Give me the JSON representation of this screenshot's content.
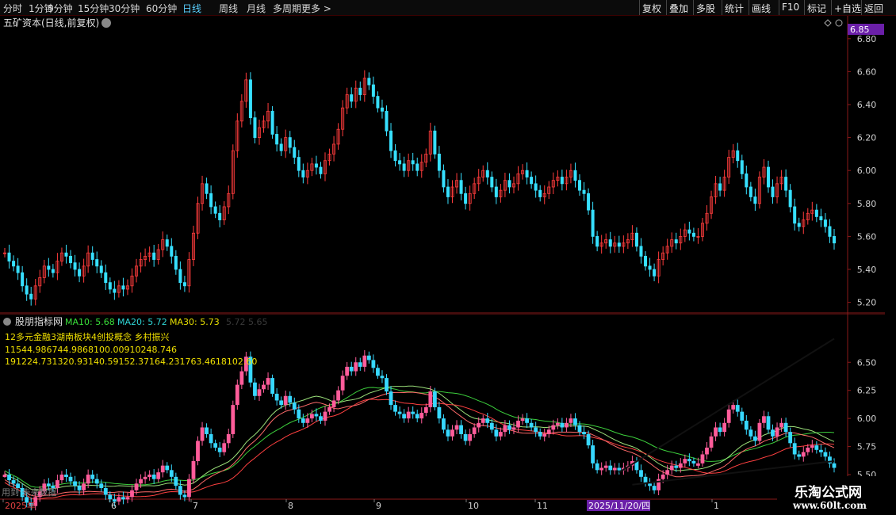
{
  "toolbar": {
    "periods": [
      "分时",
      "1分钟",
      "5分钟",
      "15分钟",
      "30分钟",
      "60分钟",
      "日线",
      "周线",
      "月线",
      "多周期",
      "更多 >"
    ],
    "active_period": "日线",
    "right_buttons": [
      "复权",
      "叠加",
      "多股",
      "统计",
      "画线",
      "F10",
      "标记",
      "+自选",
      "返回"
    ]
  },
  "main_chart": {
    "title": "五矿资本(日线,前复权)",
    "current_price_tag": "6.85",
    "y_ticks": [
      "6.80",
      "6.60",
      "6.40",
      "6.20",
      "6.00",
      "5.80",
      "5.60",
      "5.40",
      "5.20"
    ]
  },
  "sub_chart": {
    "indicator_name": "股朋指标网",
    "ma_labels": [
      "MA10: 5.68",
      "MA20: 5.72",
      "MA30: 5.73"
    ],
    "ma_faded": "5.72  5.65",
    "info_line1": "12多元金融3湖南板块4创投概念 乡村振兴",
    "info_line2": "11544.986744.9868100.00910248.746",
    "info_line3": "191224.731320.93140.59152.37164.231763.4618102.60",
    "y_ticks": [
      "6.50",
      "6.25",
      "6.00",
      "5.75",
      "5.50"
    ],
    "bottom_left_text": "用到   未来数据"
  },
  "x_axis": {
    "labels": [
      "2025年",
      "6",
      "7",
      "8",
      "9",
      "10",
      "11",
      "1"
    ],
    "highlight_date": "2025/11/20/四"
  },
  "watermark": {
    "title": "乐淘公式网",
    "url": "www.60lt.com"
  },
  "colors": {
    "up_main": "#ff3c3c",
    "down_main": "#37e0ff",
    "up_sub": "#ff5c9a",
    "down_sub": "#37d8ff",
    "ma_green": "#3ccf3c",
    "ma_red": "#ff4040",
    "ma_yellow": "#e6d34a",
    "axis_red": "#8a1a1a"
  },
  "chart_data": {
    "type": "candlestick",
    "title": "五矿资本(日线,前复权)",
    "y_range_main": [
      5.15,
      6.9
    ],
    "y_range_sub": [
      5.38,
      6.65
    ],
    "series": [
      {
        "name": "price",
        "close_values": [
          5.5,
          5.45,
          5.42,
          5.38,
          5.3,
          5.25,
          5.22,
          5.3,
          5.35,
          5.42,
          5.4,
          5.38,
          5.45,
          5.5,
          5.48,
          5.44,
          5.4,
          5.36,
          5.42,
          5.5,
          5.46,
          5.42,
          5.38,
          5.32,
          5.28,
          5.26,
          5.3,
          5.28,
          5.3,
          5.36,
          5.42,
          5.46,
          5.48,
          5.5,
          5.46,
          5.52,
          5.58,
          5.54,
          5.48,
          5.4,
          5.32,
          5.3,
          5.46,
          5.62,
          5.8,
          5.92,
          5.86,
          5.78,
          5.74,
          5.7,
          5.78,
          5.86,
          6.12,
          6.3,
          6.42,
          6.55,
          6.32,
          6.2,
          6.26,
          6.3,
          6.36,
          6.22,
          6.16,
          6.12,
          6.2,
          6.14,
          6.08,
          6.0,
          5.96,
          6.0,
          6.04,
          6.02,
          5.98,
          6.06,
          6.1,
          6.16,
          6.25,
          6.38,
          6.46,
          6.42,
          6.5,
          6.46,
          6.56,
          6.52,
          6.45,
          6.38,
          6.36,
          6.24,
          6.12,
          6.06,
          6.04,
          6.0,
          6.06,
          6.04,
          6.0,
          6.05,
          6.1,
          6.24,
          6.1,
          6.0,
          5.9,
          5.84,
          5.9,
          5.94,
          5.86,
          5.8,
          5.86,
          5.92,
          5.96,
          6.0,
          5.96,
          5.9,
          5.84,
          5.88,
          5.94,
          5.9,
          5.92,
          5.98,
          6.0,
          5.96,
          5.92,
          5.88,
          5.84,
          5.86,
          5.9,
          5.94,
          5.96,
          5.92,
          5.96,
          6.0,
          5.94,
          5.88,
          5.86,
          5.76,
          5.6,
          5.54,
          5.56,
          5.58,
          5.54,
          5.56,
          5.54,
          5.56,
          5.58,
          5.62,
          5.54,
          5.48,
          5.42,
          5.4,
          5.36,
          5.46,
          5.5,
          5.54,
          5.58,
          5.56,
          5.6,
          5.64,
          5.62,
          5.6,
          5.6,
          5.68,
          5.74,
          5.84,
          5.92,
          5.88,
          5.96,
          6.08,
          6.12,
          6.06,
          5.98,
          5.9,
          5.84,
          5.8,
          5.96,
          6.02,
          5.9,
          5.84,
          5.92,
          5.96,
          5.88,
          5.78,
          5.68,
          5.66,
          5.7,
          5.74,
          5.76,
          5.72,
          5.7,
          5.66,
          5.6,
          5.56
        ]
      }
    ],
    "ma_lines": [
      "MA10",
      "MA20",
      "MA30"
    ]
  }
}
